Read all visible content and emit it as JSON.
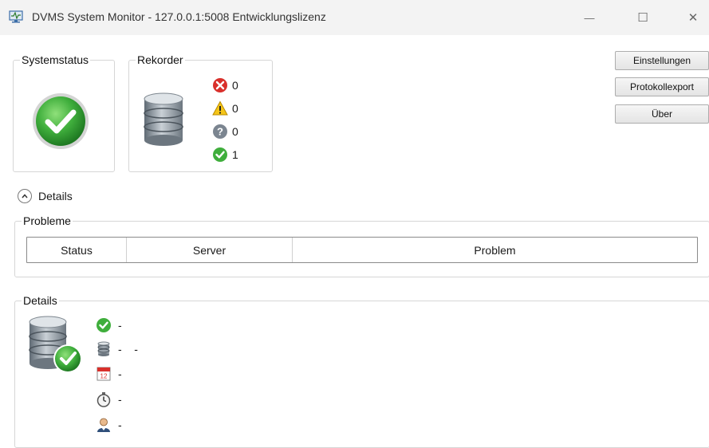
{
  "window": {
    "title": "DVMS System Monitor - 127.0.0.1:5008 Entwicklungslizenz",
    "minimize_glyph": "—",
    "maximize_glyph": "☐",
    "close_glyph": "✕"
  },
  "systemstatus": {
    "legend": "Systemstatus",
    "icon": "green-check-large-icon"
  },
  "rekorder": {
    "legend": "Rekorder",
    "counts": [
      {
        "icon": "error-icon",
        "value": "0"
      },
      {
        "icon": "warning-icon",
        "value": "0"
      },
      {
        "icon": "unknown-icon",
        "value": "0"
      },
      {
        "icon": "ok-icon",
        "value": "1"
      }
    ]
  },
  "buttons": {
    "settings": "Einstellungen",
    "log_export": "Protokollexport",
    "about": "Über"
  },
  "expander": {
    "label": "Details"
  },
  "problems": {
    "legend": "Probleme",
    "columns": [
      "Status",
      "Server",
      "Problem"
    ],
    "rows": []
  },
  "details": {
    "legend": "Details",
    "rows": [
      {
        "icon": "ok-icon",
        "text": "-"
      },
      {
        "icon": "database-icon",
        "text": "-    -"
      },
      {
        "icon": "calendar-icon",
        "text": "-"
      },
      {
        "icon": "stopwatch-icon",
        "text": "-"
      },
      {
        "icon": "user-icon",
        "text": "-"
      }
    ]
  },
  "colors": {
    "ok": "#3fae3c",
    "error": "#d9302b",
    "warning": "#f5c518",
    "unknown": "#7b8590"
  }
}
